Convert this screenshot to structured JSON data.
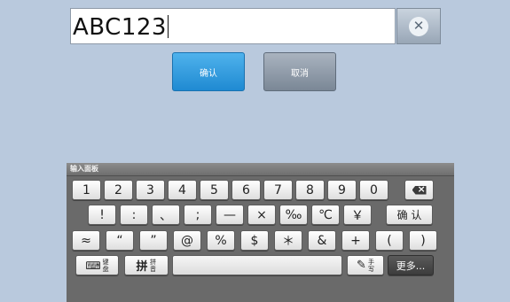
{
  "input": {
    "value": "ABC123"
  },
  "icons": {
    "clear": "clear-icon",
    "backspace": "backspace-icon",
    "keyboard": "keyboard-icon",
    "handwrite": "handwrite-icon"
  },
  "buttons": {
    "ok": "确认",
    "cancel": "取消"
  },
  "panel": {
    "title": "输入面板"
  },
  "keyboard": {
    "row1": [
      "1",
      "2",
      "3",
      "4",
      "5",
      "6",
      "7",
      "8",
      "9",
      "0"
    ],
    "row2": [
      "!",
      ":",
      "、",
      ";",
      "—",
      "×",
      "‰",
      "℃",
      "￥",
      "确 认"
    ],
    "row3": [
      "≈",
      "“",
      "”",
      "@",
      "%",
      "$",
      "＊",
      "&",
      "+",
      "(",
      ")"
    ],
    "row4": {
      "keyboard_main": "键",
      "keyboard_sub": "盘",
      "pinyin_main": "拼",
      "pinyin_sub": "拼音",
      "handwrite_main": "手",
      "handwrite_sub": "写",
      "more": "更多..."
    }
  },
  "colors": {
    "background": "#b9c9dd",
    "ok_button": "#2a95dc",
    "cancel_button": "#8a96a4",
    "panel": "#6a6a6a"
  }
}
